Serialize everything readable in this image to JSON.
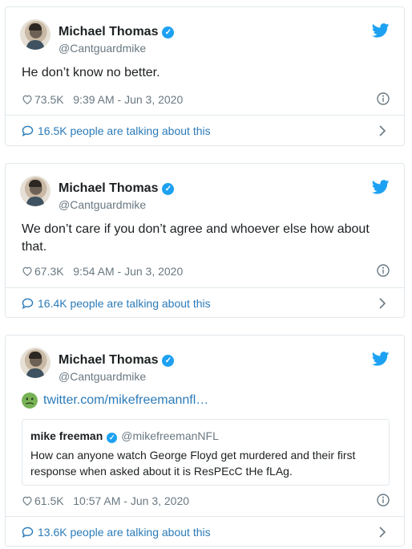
{
  "tweets": [
    {
      "author": {
        "name": "Michael Thomas",
        "handle": "@Cantguardmike"
      },
      "text": "He don’t know no better.",
      "likes": "73.5K",
      "time": "9:39 AM - Jun 3, 2020",
      "talking": "16.5K people are talking about this"
    },
    {
      "author": {
        "name": "Michael Thomas",
        "handle": "@Cantguardmike"
      },
      "text": "We don’t care if you don’t agree and whoever else how about that.",
      "likes": "67.3K",
      "time": "9:54 AM - Jun 3, 2020",
      "talking": "16.4K people are talking about this"
    },
    {
      "author": {
        "name": "Michael Thomas",
        "handle": "@Cantguardmike"
      },
      "emoji": "nauseated-face",
      "link": "twitter.com/mikefreemannfl…",
      "quoted": {
        "name": "mike freeman",
        "handle": "@mikefreemanNFL",
        "text": "How can anyone watch George Floyd get murdered and their first response when asked about it is ResPEcC tHe fLAg."
      },
      "likes": "61.5K",
      "time": "10:57 AM - Jun 3, 2020",
      "talking": "13.6K people are talking about this"
    }
  ],
  "colors": {
    "link_blue": "#2b7bb9",
    "twitter_blue": "#1da1f2",
    "meta_gray": "#697882",
    "border": "#e1e8ed",
    "emoji_green": "#77b255"
  },
  "icons": [
    "twitter-bird-icon",
    "verified-badge-icon",
    "heart-icon",
    "info-icon",
    "speech-bubble-icon",
    "chevron-right-icon",
    "nauseated-face-emoji"
  ]
}
